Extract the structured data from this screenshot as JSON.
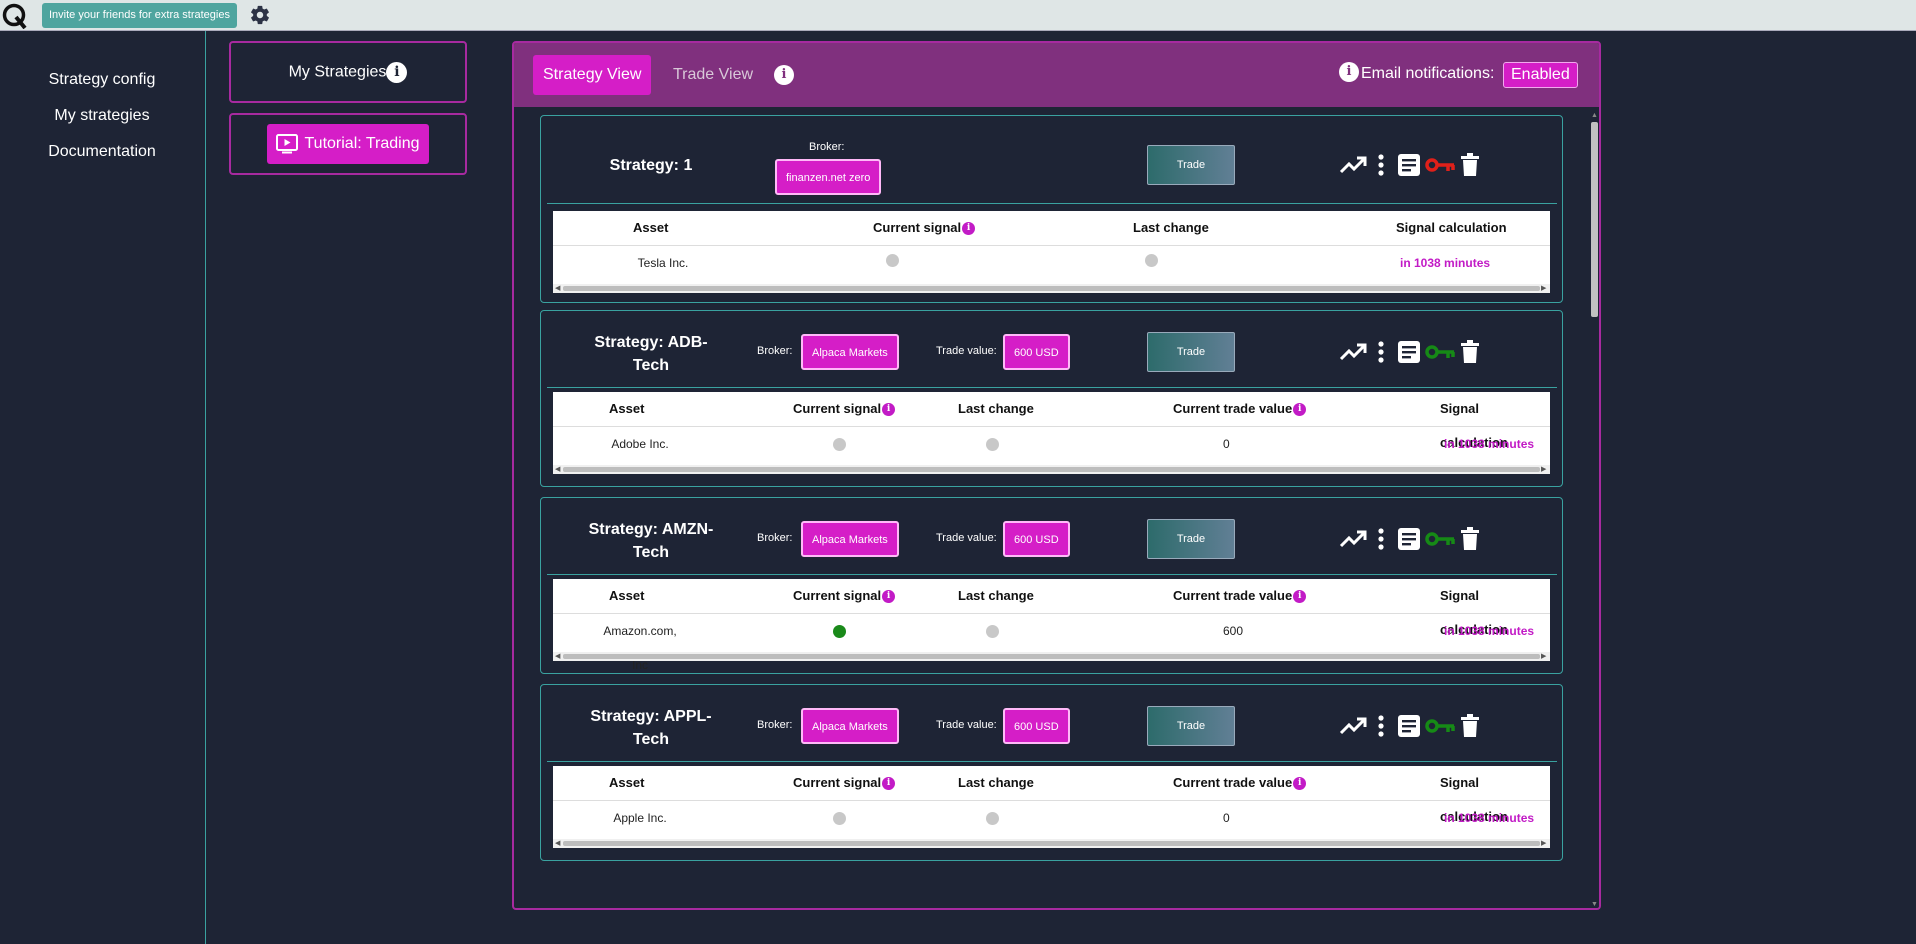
{
  "topbar": {
    "invite_label": "Invite your friends for extra strategies",
    "logo_icon": "q-logo-icon",
    "settings_icon": "gear-icon"
  },
  "nav": {
    "items": [
      "Strategy config",
      "My strategies",
      "Documentation"
    ]
  },
  "sidebar": {
    "my_strategies_label": "My Strategies",
    "tutorial_label": "Tutorial: Trading"
  },
  "panel": {
    "tabs": [
      "Strategy View",
      "Trade View"
    ],
    "active_tab": "Strategy View",
    "email_label": "Email notifications:",
    "email_status": "Enabled"
  },
  "labels": {
    "broker": "Broker:",
    "trade_value": "Trade value:",
    "trade_button": "Trade"
  },
  "colors": {
    "accent": "#d51ec7",
    "header": "#80307e",
    "teal": "#3aa2a0",
    "background": "#1e2435",
    "signal_on": "#1a8a1a",
    "signal_off": "#c8c8c8",
    "key_red": "#e0201a",
    "key_green": "#168a16"
  },
  "strategies": [
    {
      "title_line1": "Strategy: 1",
      "title_line2": "",
      "broker": "finanzen.net zero",
      "trade_value": "",
      "key_status": "red",
      "columns": [
        "Asset",
        "Current signal",
        "Last change",
        "Signal calculation"
      ],
      "row": {
        "asset": "Tesla Inc.",
        "current_signal": "off",
        "last_change": "off",
        "trade_value": "",
        "signal_calc": "in 1038 minutes"
      }
    },
    {
      "title_line1": "Strategy: ADB-",
      "title_line2": "Tech",
      "broker": "Alpaca Markets",
      "trade_value": "600 USD",
      "key_status": "green",
      "columns": [
        "Asset",
        "Current signal",
        "Last change",
        "Current trade value",
        "Signal calculation"
      ],
      "row": {
        "asset": "Adobe Inc.",
        "current_signal": "off",
        "last_change": "off",
        "trade_value": "0",
        "signal_calc": "in 1038 minutes"
      }
    },
    {
      "title_line1": "Strategy: AMZN-",
      "title_line2": "Tech",
      "broker": "Alpaca Markets",
      "trade_value": "600 USD",
      "key_status": "green",
      "columns": [
        "Asset",
        "Current signal",
        "Last change",
        "Current trade value",
        "Signal calculation"
      ],
      "row": {
        "asset": "Amazon.com, Inc",
        "current_signal": "on",
        "last_change": "off",
        "trade_value": "600",
        "signal_calc": "in 1038 minutes"
      }
    },
    {
      "title_line1": "Strategy: APPL-",
      "title_line2": "Tech",
      "broker": "Alpaca Markets",
      "trade_value": "600 USD",
      "key_status": "green",
      "columns": [
        "Asset",
        "Current signal",
        "Last change",
        "Current trade value",
        "Signal calculation"
      ],
      "row": {
        "asset": "Apple Inc.",
        "current_signal": "off",
        "last_change": "off",
        "trade_value": "0",
        "signal_calc": "in 1038 minutes"
      }
    }
  ]
}
